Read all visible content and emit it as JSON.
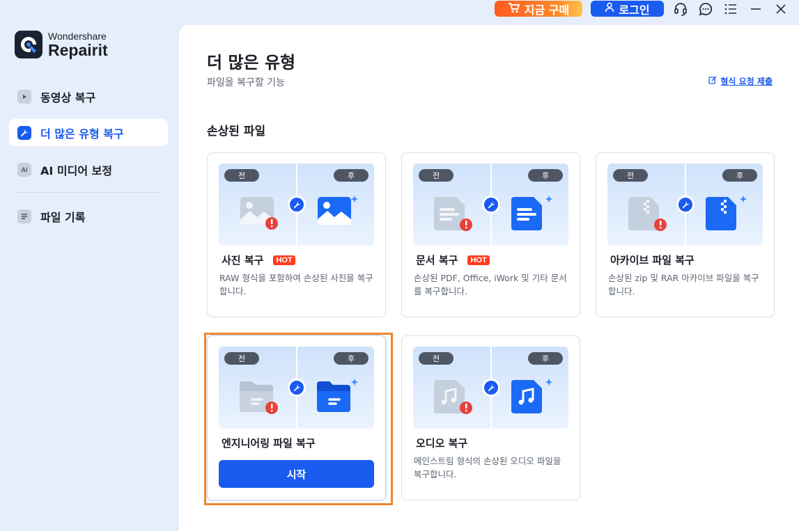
{
  "titlebar": {
    "buy_label": "지금 구매",
    "login_label": "로그인",
    "icons": [
      "headset-icon",
      "chat-icon",
      "menu-icon",
      "minimize-icon",
      "close-icon"
    ]
  },
  "sidebar": {
    "brand": "Wondershare",
    "product": "Repairit",
    "items": [
      {
        "label": "동영상 복구",
        "icon": "video-icon",
        "active": false
      },
      {
        "label": "더 많은 유형 복구",
        "icon": "wrench-icon",
        "active": true
      },
      {
        "label": "AI 미디어 보정",
        "icon": "ai-icon",
        "active": false
      },
      {
        "label": "파일 기록",
        "icon": "file-list-icon",
        "active": false
      }
    ]
  },
  "main": {
    "title": "더 많은 유형",
    "subtitle": "파일을 복구할 기능",
    "request_link": "형식 요청 제출",
    "section_title": "손상된 파일",
    "before_label": "전",
    "after_label": "후",
    "cards": [
      {
        "title": "사진 복구",
        "hot": "HOT",
        "desc": "RAW 형식을 포함하여 손상된 사진을 복구합니다.",
        "icon": "photo-icon"
      },
      {
        "title": "문서 복구",
        "hot": "HOT",
        "desc": "손상된 PDF, Office, iWork 및 기타 문서를 복구합니다.",
        "icon": "document-icon"
      },
      {
        "title": "아카이브 파일 복구",
        "desc": "손상된 zip 및 RAR 아카이브 파일을 복구합니다.",
        "icon": "archive-icon"
      },
      {
        "title": "엔지니어링 파일 복구",
        "button": "시작",
        "icon": "folder-icon"
      },
      {
        "title": "오디오 복구",
        "desc": "메인스트림 형식의 손상된 오디오 파일을 복구합니다.",
        "icon": "audio-icon"
      }
    ]
  },
  "colors": {
    "accent": "#1a5bf0",
    "hot": "#ff3b1f",
    "highlight": "#f0862e",
    "error": "#e8413c"
  }
}
